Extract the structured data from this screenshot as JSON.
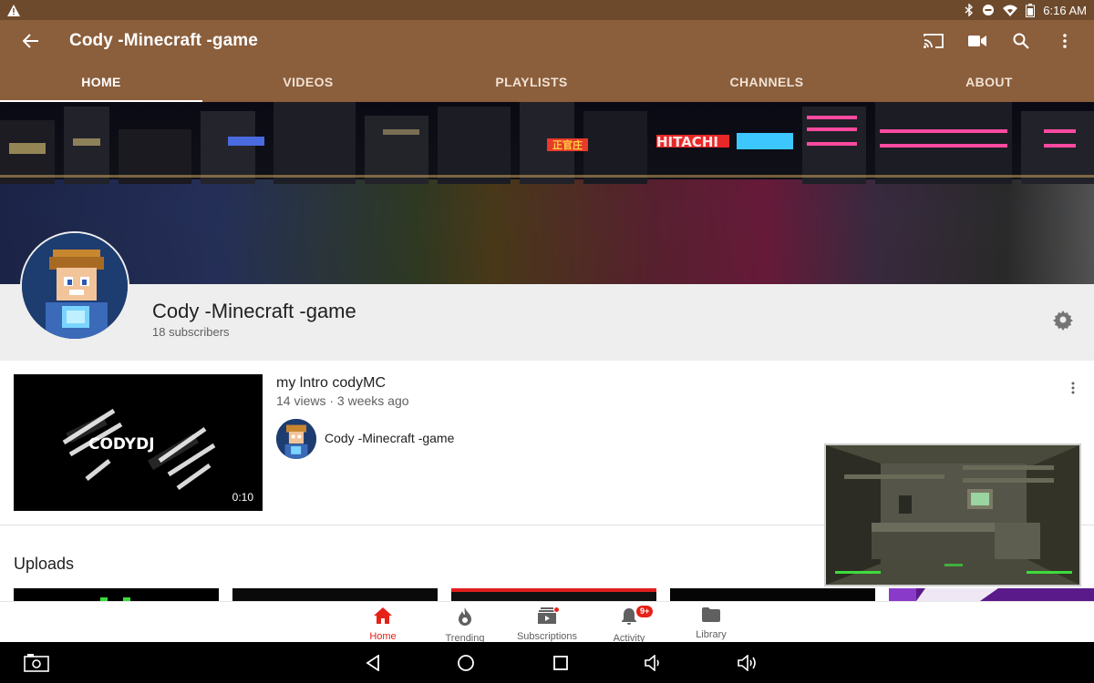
{
  "status_bar": {
    "time": "6:16 AM",
    "icons": [
      "warning-icon",
      "bluetooth-icon",
      "do-not-disturb-icon",
      "wifi-icon",
      "battery-icon"
    ]
  },
  "app_bar": {
    "title": "Cody -Minecraft -game",
    "icons": [
      "back-arrow-icon",
      "cast-icon",
      "camera-icon",
      "search-icon",
      "more-vert-icon"
    ]
  },
  "tabs": [
    {
      "label": "HOME",
      "active": true
    },
    {
      "label": "VIDEOS",
      "active": false
    },
    {
      "label": "PLAYLISTS",
      "active": false
    },
    {
      "label": "CHANNELS",
      "active": false
    },
    {
      "label": "ABOUT",
      "active": false
    }
  ],
  "banner": {
    "signs": [
      "HITACHI",
      "正官庄"
    ]
  },
  "channel": {
    "name": "Cody -Minecraft -game",
    "subscribers": "18 subscribers"
  },
  "featured_video": {
    "title": "my lntro codyMC",
    "meta": "14 views · 3 weeks ago",
    "duration": "0:10",
    "thumb_text": "CODYDJ",
    "channel_name": "Cody -Minecraft -game"
  },
  "uploads": {
    "title": "Uploads"
  },
  "bottom_nav": [
    {
      "label": "Home",
      "icon": "home-icon",
      "active": true
    },
    {
      "label": "Trending",
      "icon": "flame-icon",
      "active": false
    },
    {
      "label": "Subscriptions",
      "icon": "subscriptions-icon",
      "active": false
    },
    {
      "label": "Activity",
      "icon": "bell-icon",
      "active": false,
      "badge": "9+"
    },
    {
      "label": "Library",
      "icon": "folder-icon",
      "active": false
    }
  ],
  "colors": {
    "app_bar": "#8b5e3c",
    "status_bar": "#6e4a2c",
    "accent": "#e62117"
  }
}
